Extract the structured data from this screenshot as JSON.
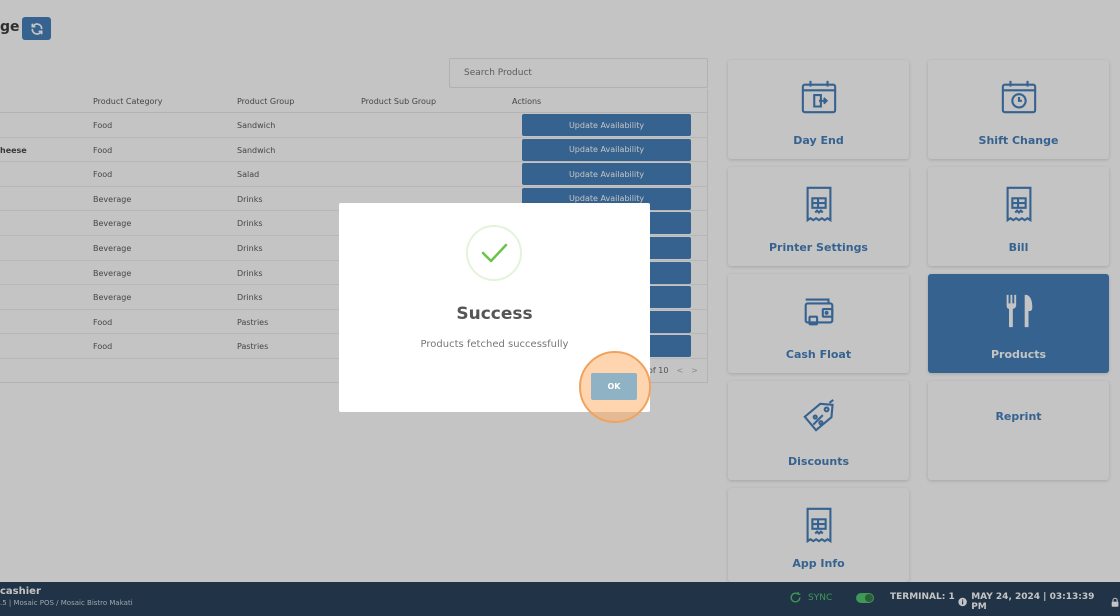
{
  "header": {
    "title": "ge"
  },
  "search": {
    "placeholder": "Search Product"
  },
  "table": {
    "headers": {
      "category": "Product Category",
      "group": "Product Group",
      "subgroup": "Product Sub Group",
      "actions": "Actions"
    },
    "rows": [
      {
        "name": "",
        "category": "Food",
        "group": "Sandwich",
        "action": "Update Availability"
      },
      {
        "name": "heese",
        "category": "Food",
        "group": "Sandwich",
        "action": "Update Availability"
      },
      {
        "name": "",
        "category": "Food",
        "group": "Salad",
        "action": "Update Availability"
      },
      {
        "name": "",
        "category": "Beverage",
        "group": "Drinks",
        "action": "Update Availability"
      },
      {
        "name": "",
        "category": "Beverage",
        "group": "Drinks",
        "action": ""
      },
      {
        "name": "",
        "category": "Beverage",
        "group": "Drinks",
        "action": ""
      },
      {
        "name": "",
        "category": "Beverage",
        "group": "Drinks",
        "action": ""
      },
      {
        "name": "",
        "category": "Beverage",
        "group": "Drinks",
        "action": ""
      },
      {
        "name": "",
        "category": "Food",
        "group": "Pastries",
        "action": ""
      },
      {
        "name": "",
        "category": "Food",
        "group": "Pastries",
        "action": ""
      }
    ],
    "pagination": "of 10"
  },
  "tiles": [
    {
      "label": "Day End",
      "icon": "calendar-exit-icon"
    },
    {
      "label": "Shift Change",
      "icon": "calendar-clock-icon"
    },
    {
      "label": "Printer Settings",
      "icon": "receipt-icon"
    },
    {
      "label": "Bill",
      "icon": "receipt-icon"
    },
    {
      "label": "Cash Float",
      "icon": "wallet-icon"
    },
    {
      "label": "Products",
      "icon": "utensils-icon"
    },
    {
      "label": "Discounts",
      "icon": "price-tag-icon"
    },
    {
      "label": "Reprint",
      "icon": ""
    },
    {
      "label": "App Info",
      "icon": "receipt-icon"
    }
  ],
  "modal": {
    "title": "Success",
    "message": "Products fetched successfully",
    "ok_label": "OK"
  },
  "footer": {
    "user": "cashier",
    "subtitle": ".5 | Mosaic POS / Mosaic Bistro Makati",
    "sync": "SYNC",
    "terminal": "TERMINAL: 1",
    "datetime": "MAY 24, 2024 | 03:13:39 PM"
  },
  "colors": {
    "primary": "#2e6fb3",
    "footer": "#0f2a47",
    "success": "#6cc24a",
    "highlight": "#f0a35e"
  }
}
